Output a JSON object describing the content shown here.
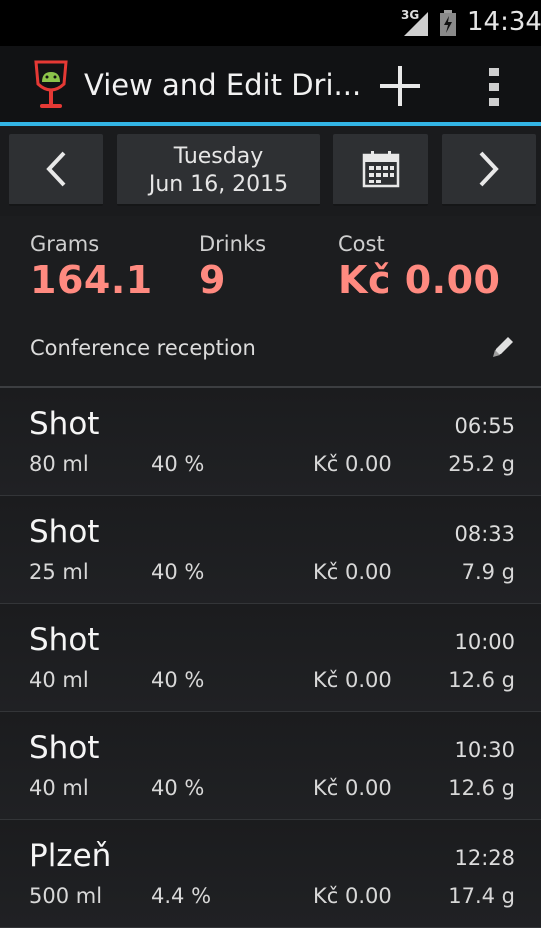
{
  "status_bar": {
    "network": "3G",
    "time": "14:34"
  },
  "action_bar": {
    "title": "View and Edit Dri...",
    "logo_icon": "wine-glass-android-icon",
    "add_icon": "plus-icon",
    "menu_icon": "overflow-menu-icon"
  },
  "date_nav": {
    "prev_icon": "chevron-left-icon",
    "day": "Tuesday",
    "date": "Jun 16, 2015",
    "calendar_icon": "calendar-icon",
    "next_icon": "chevron-right-icon"
  },
  "summary": {
    "grams_label": "Grams",
    "grams_value": "164.1",
    "drinks_label": "Drinks",
    "drinks_value": "9",
    "cost_label": "Cost",
    "cost_value": "Kč 0.00",
    "note": "Conference reception",
    "edit_icon": "pencil-icon"
  },
  "drinks": [
    {
      "name": "Shot",
      "time": "06:55",
      "volume": "80 ml",
      "abv": "40 %",
      "cost": "Kč 0.00",
      "grams": "25.2 g"
    },
    {
      "name": "Shot",
      "time": "08:33",
      "volume": "25 ml",
      "abv": "40 %",
      "cost": "Kč 0.00",
      "grams": "7.9 g"
    },
    {
      "name": "Shot",
      "time": "10:00",
      "volume": "40 ml",
      "abv": "40 %",
      "cost": "Kč 0.00",
      "grams": "12.6 g"
    },
    {
      "name": "Shot",
      "time": "10:30",
      "volume": "40 ml",
      "abv": "40 %",
      "cost": "Kč 0.00",
      "grams": "12.6 g"
    },
    {
      "name": "Plzeň",
      "time": "12:28",
      "volume": "500 ml",
      "abv": "4.4 %",
      "cost": "Kč 0.00",
      "grams": "17.4 g"
    }
  ],
  "colors": {
    "accent": "#33b5e5",
    "value_red": "#ff8a80"
  }
}
